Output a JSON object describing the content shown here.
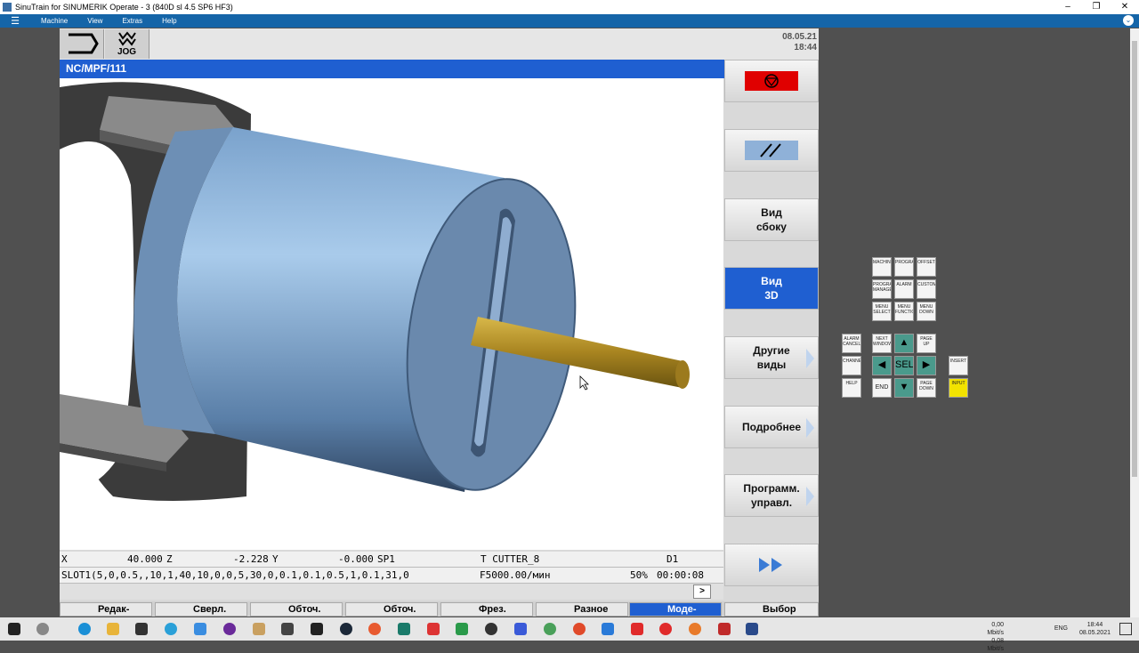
{
  "window": {
    "title": "SinuTrain for SINUMERIK Operate - 3 (840D sl 4.5 SP6 HF3)"
  },
  "menu": {
    "items": [
      "Machine",
      "View",
      "Extras",
      "Help"
    ]
  },
  "header": {
    "mode": "JOG",
    "date": "08.05.21",
    "time": "18:44"
  },
  "path": "NC/MPF/111",
  "status": {
    "x_label": "X",
    "x_value": "40.000",
    "z_label": "Z",
    "z_value": "-2.228",
    "y_label": "Y",
    "y_value": "-0.000",
    "sp_label": "SP1",
    "tool": "T CUTTER_8",
    "d": "D1",
    "program_line": "SLOT1(5,0,0.5,,10,1,40,10,0,0,5,30,0,0.1,0.1,0.5,1,0.1,31,0",
    "feed": "F5000.00/мин",
    "override": "50%",
    "time": "00:00:08"
  },
  "arrow": ">",
  "vsk": {
    "side_line1": "Вид",
    "side_line2": "сбоку",
    "v3d_line1": "Вид",
    "v3d_line2": "3D",
    "other_line1": "Другие",
    "other_line2": "виды",
    "details": "Подробнее",
    "prog_line1": "Программ.",
    "prog_line2": "управл."
  },
  "hsk": [
    "Редак-",
    "Сверл.",
    "Обточ.",
    "Обточ.",
    "Фрез.",
    "Разное",
    "Моде-",
    "Выбор"
  ],
  "keys": {
    "machine": "MACHINE",
    "program": "PROGRAM",
    "offset": "OFFSET",
    "prog_manager": "PROGRAM MANAGER",
    "alarm": "ALARM",
    "custom": "CUSTOM",
    "menu_select": "MENU SELECT",
    "menu_function": "MENU FUNCTION",
    "menu_down": "MENU DOWN",
    "alarm_cancel": "ALARM CANCEL",
    "next_window": "NEXT WINDOW",
    "page_up": "PAGE UP",
    "channel": "CHANNEL",
    "select": "SELECT",
    "insert": "INSERT",
    "help": "HELP",
    "end": "END",
    "page_down": "PAGE DOWN",
    "input": "INPUT"
  },
  "tray": {
    "net_up": "0,00 Mbit/s",
    "net_down": "0,08 Mbit/s",
    "lang": "ENG",
    "time": "18:44",
    "date": "08.05.2021"
  },
  "colors": {
    "accent": "#1f5fd1",
    "cylinder": "#8db4e0",
    "tool": "#b8962e"
  }
}
